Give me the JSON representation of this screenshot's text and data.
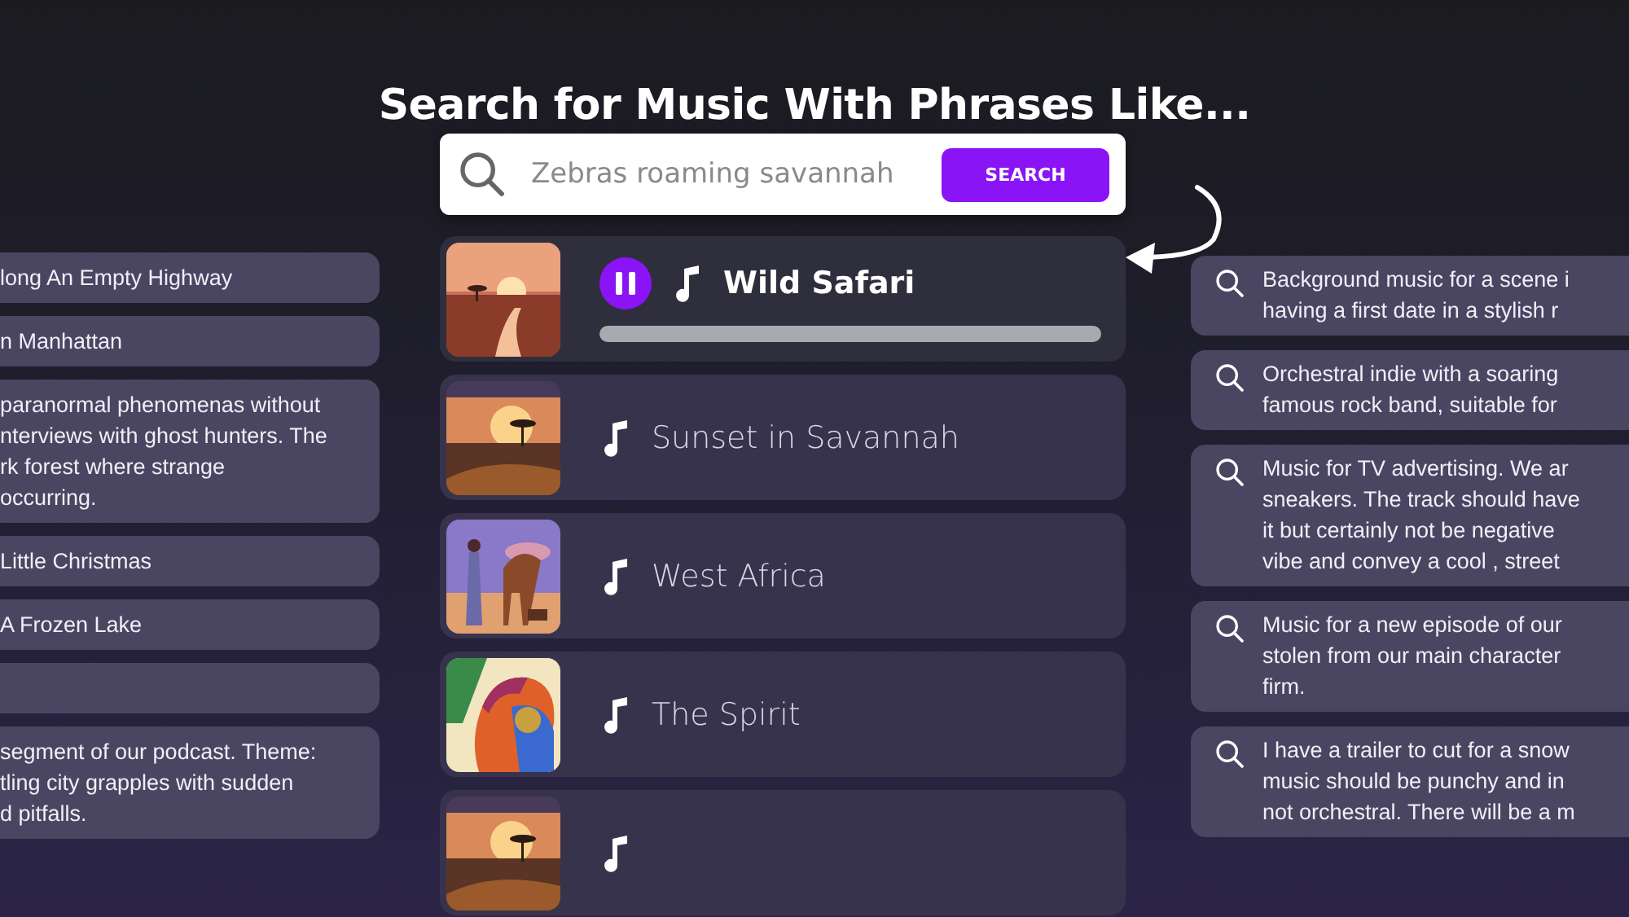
{
  "heading": "Search for Music With Phrases Like...",
  "search": {
    "placeholder": "Zebras roaming savannah",
    "button": "SEARCH"
  },
  "tracks": [
    {
      "title": "Wild Safari",
      "playing": true,
      "level": 0
    },
    {
      "title": "Sunset in Savannah",
      "playing": false
    },
    {
      "title": "West Africa",
      "playing": false
    },
    {
      "title": "The Spirit",
      "playing": false
    },
    {
      "playing": false
    }
  ],
  "left_phrases": [
    {
      "text": "long An Empty Highway"
    },
    {
      "text": "n Manhattan"
    },
    {
      "text": "paranormal phenomenas without\nnterviews with ghost hunters. The\nrk forest where strange\noccurring."
    },
    {
      "text": "Little Christmas"
    },
    {
      "text": "A Frozen Lake"
    },
    {
      "kind": "blank"
    },
    {
      "text": "segment of our podcast. Theme:\ntling city grapples with sudden\nd pitfalls."
    }
  ],
  "right_phrases": [
    {
      "text": "Background music for a scene i\nhaving a first date in a stylish r"
    },
    {
      "text": "Orchestral indie with a soaring\nfamous rock band, suitable for"
    },
    {
      "text": "Music for TV advertising. We ar\nsneakers. The track should have\nit but certainly not be negative\nvibe and convey a cool , street"
    },
    {
      "text": "Music for a new episode of our\nstolen from our main character\nfirm."
    },
    {
      "text": "I have a trailer to cut for a snow\nmusic should be punchy and in\nnot orchestral. There will be a m"
    }
  ]
}
